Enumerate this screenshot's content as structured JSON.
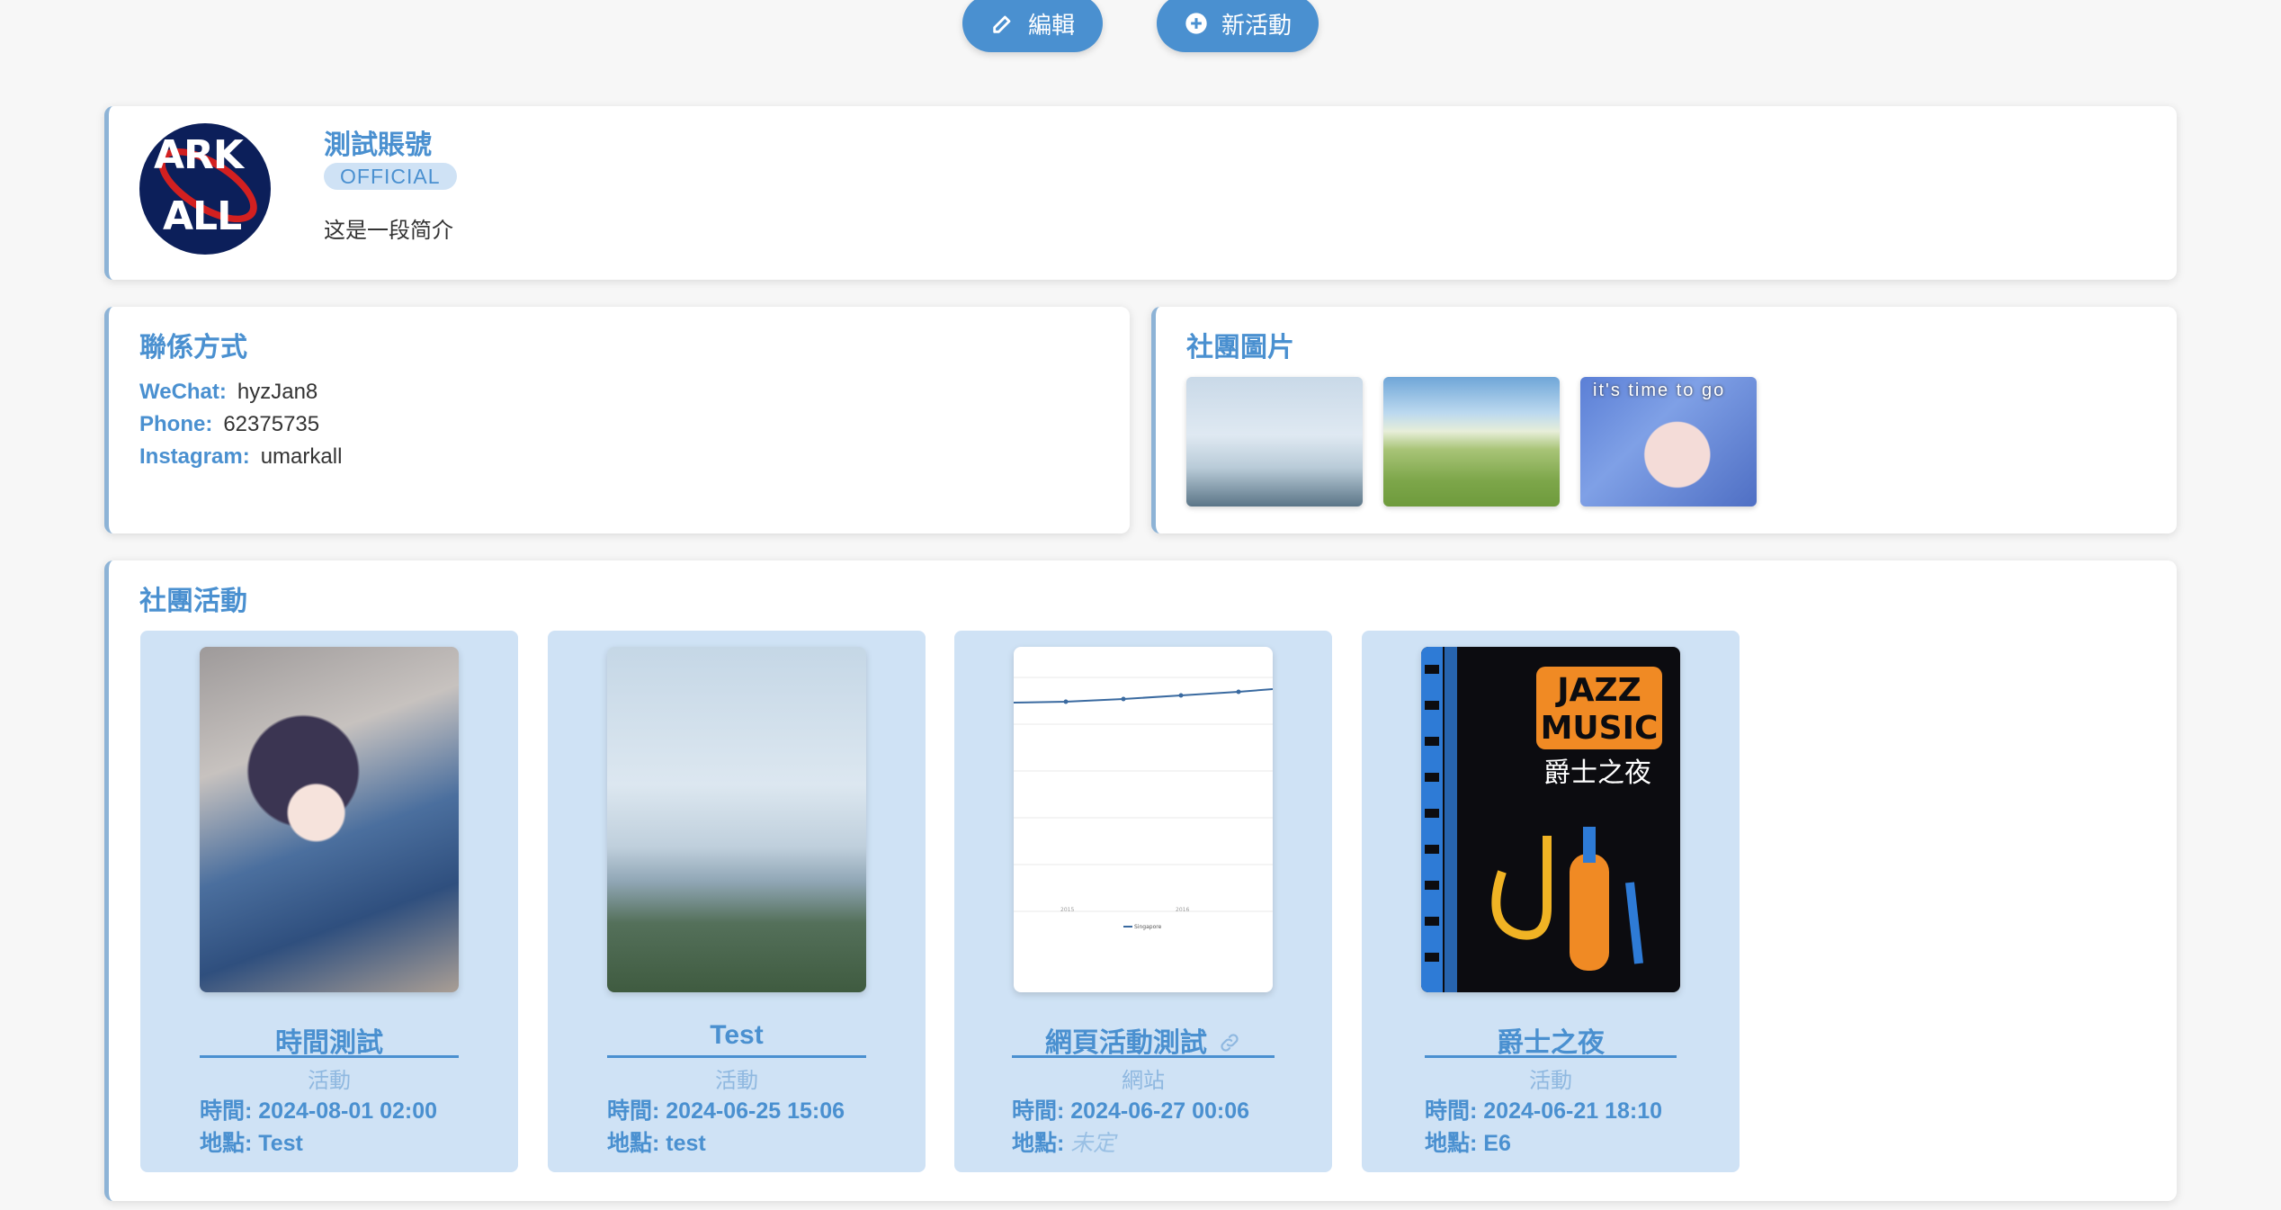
{
  "toolbar": {
    "edit_label": "編輯",
    "new_event_label": "新活動",
    "edit_icon": "edit-icon",
    "new_icon": "plus-circle-icon"
  },
  "profile": {
    "name": "測試賬號",
    "badge": "OFFICIAL",
    "bio": "这是一段简介",
    "avatar_text_top": "ARK",
    "avatar_text_bottom": "ALL"
  },
  "contact": {
    "title": "聯係方式",
    "items": [
      {
        "key": "WeChat:",
        "value": "hyzJan8"
      },
      {
        "key": "Phone:",
        "value": "62375735"
      },
      {
        "key": "Instagram:",
        "value": "umarkall"
      }
    ]
  },
  "photos": {
    "title": "社團圖片",
    "third_caption": "it's time to go"
  },
  "events": {
    "title": "社團活動",
    "time_label": "時間:",
    "place_label": "地點:",
    "items": [
      {
        "title": "時間測試",
        "type": "活動",
        "time": "2024-08-01 02:00",
        "place": "Test"
      },
      {
        "title": "Test",
        "type": "活動",
        "time": "2024-06-25 15:06",
        "place": "test"
      },
      {
        "title": "網頁活動測試",
        "type": "網站",
        "time": "2024-06-27 00:06",
        "place": "未定",
        "link_icon": "link-icon"
      },
      {
        "title": "爵士之夜",
        "type": "活動",
        "time": "2024-06-21 18:10",
        "place": "E6"
      }
    ],
    "chart_thumb": {
      "legend": "Singapore",
      "x_ticks": [
        "2015",
        "2016"
      ]
    },
    "poster": {
      "line1": "JAZZ",
      "line2": "MUSIC",
      "sub": "爵士之夜"
    }
  },
  "colors": {
    "accent": "#4a90d0",
    "card_bg": "#cfe2f5"
  }
}
